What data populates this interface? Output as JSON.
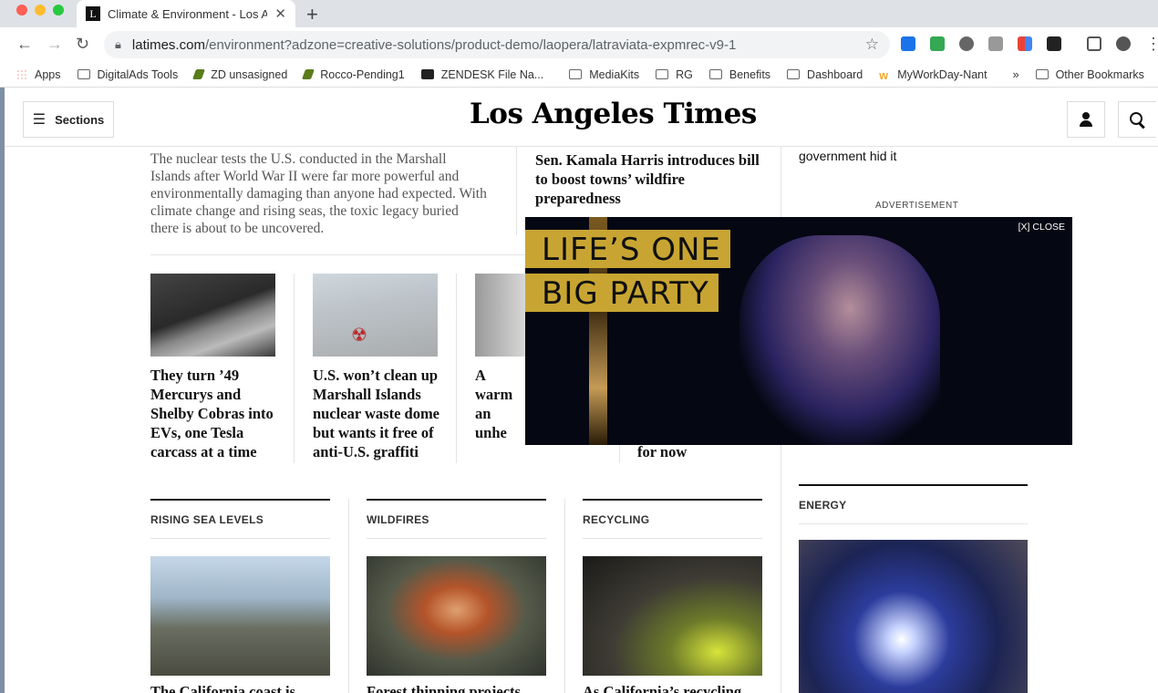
{
  "browser": {
    "tab_title": "Climate & Environment - Los A",
    "tab_favicon_letter": "L",
    "url_host": "latimes.com",
    "url_path": "/environment?adzone=creative-solutions/product-demo/laopera/latraviata-expmrec-v9-1",
    "bookmarks": [
      "Apps",
      "DigitalAds Tools",
      "ZD unsasigned",
      "Rocco-Pending1",
      "ZENDESK File Na...",
      "MediaKits",
      "RG",
      "Benefits",
      "Dashboard",
      "MyWorkDay-Nant"
    ],
    "bookmarks_overflow": "»",
    "other_bookmarks": "Other Bookmarks"
  },
  "header": {
    "sections_label": "Sections",
    "logo": "Los Angeles Times"
  },
  "content": {
    "dek": "The nuclear tests the U.S. conducted in the Marshall Islands after World War II were far more powerful and environmentally damaging than anyone had expected. With climate change and rising seas, the toxic legacy buried there is about to be uncovered.",
    "headline_top": "Sen. Kamala Harris introduces bill to boost towns’ wildfire preparedness",
    "right_top": "government hid it",
    "ad_label": "ADVERTISEMENT",
    "cards": [
      {
        "headline": "They turn ’49 Mercurys and Shelby Cobras into EVs, one Tesla carcass at a time"
      },
      {
        "headline": "U.S. won’t clean up Marshall Islands nuclear waste dome but wants it free of anti-U.S. graffiti"
      },
      {
        "headline": "A warm an unhe place fo doctors"
      },
      {
        "headline": "for now"
      }
    ],
    "sections": [
      {
        "label": "RISING SEA LEVELS",
        "headline": "The California coast is"
      },
      {
        "label": "WILDFIRES",
        "headline": "Forest thinning projects"
      },
      {
        "label": "RECYCLING",
        "headline": "As California’s recycling"
      },
      {
        "label": "ENERGY",
        "headline": ""
      }
    ]
  },
  "ad": {
    "line1": "LIFE’S ONE",
    "line2": "BIG PARTY",
    "close_label": "[X] CLOSE"
  }
}
